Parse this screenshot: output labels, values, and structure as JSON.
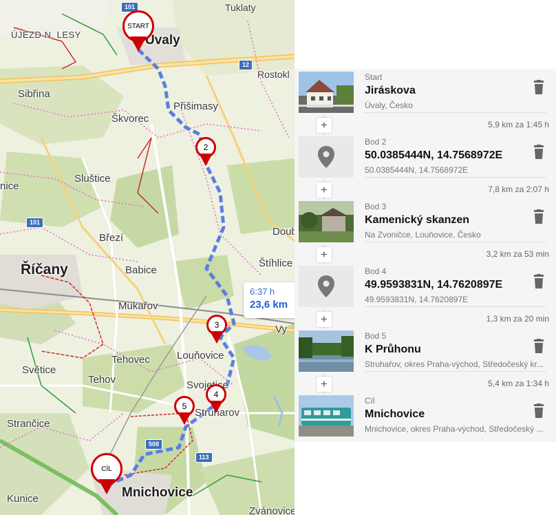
{
  "map": {
    "places": {
      "tuklaty": "Tuklaty",
      "ujezd": "ÚJEZD N. LESY",
      "uvaly": "Úvaly",
      "rostoklaty": "Rostokl",
      "sibrina": "Sibřina",
      "prisimasy": "Přišimasy",
      "skvorec": "Škvorec",
      "nice": "nice",
      "slustice": "Sluštice",
      "doubek": "Doub",
      "brezi": "Březí",
      "stihlice": "Štíhlice",
      "ricany": "Říčany",
      "babice": "Babice",
      "mukarov": "Mukařov",
      "tehovec": "Tehovec",
      "svetice": "Světice",
      "tehov": "Tehov",
      "lounovice": "Louňovice",
      "svojetice": "Svojetice",
      "struharov": "Struharov",
      "strancice": "Strančice",
      "mnichovice": "Mnichovice",
      "kunice": "Kunice",
      "zvanovice": "Zvánovice",
      "vy": "Vy"
    },
    "shields": {
      "r101_top": "101",
      "r12": "12",
      "r101_left": "101",
      "r508": "508",
      "r113": "113"
    },
    "markers": {
      "start": "START",
      "p2": "2",
      "p3": "3",
      "p4": "4",
      "p5": "5",
      "cil": "CÍL"
    },
    "summary": {
      "time": "6:37 h",
      "distance": "23,6 km"
    },
    "colors": {
      "route": "#5b7fe0",
      "marker": "#cc0000",
      "forest": "#cbdcaa",
      "field": "#e9ecd9"
    }
  },
  "panel": {
    "stops": [
      {
        "kind": "Start",
        "name": "Jiráskova",
        "address": "Úvaly, Česko",
        "thumb": "photo-house-street"
      },
      {
        "kind": "Bod 2",
        "name": "50.0385444N, 14.7568972E",
        "address": "50.0385444N, 14.7568972E",
        "thumb": "map-pin-icon"
      },
      {
        "kind": "Bod 3",
        "name": "Kamenický skanzen",
        "address": "Na Zvoničce, Louňovice, Česko",
        "thumb": "photo-stone-building"
      },
      {
        "kind": "Bod 4",
        "name": "49.9593831N, 14.7620897E",
        "address": "49.9593831N, 14.7620897E",
        "thumb": "map-pin-icon"
      },
      {
        "kind": "Bod 5",
        "name": "K Průhonu",
        "address": "Struhařov, okres Praha-východ, Středočeský kr...",
        "thumb": "photo-pond"
      },
      {
        "kind": "Cíl",
        "name": "Mnichovice",
        "address": "Mnichovice, okres Praha-východ, Středočeský ...",
        "thumb": "photo-train"
      }
    ],
    "legs": [
      "5,9 km za 1:45 h",
      "7,8 km za 2:07 h",
      "3,2 km za 53 min",
      "1,3 km za 20 min",
      "5,4 km za 1:34 h"
    ],
    "add_label": "+"
  }
}
